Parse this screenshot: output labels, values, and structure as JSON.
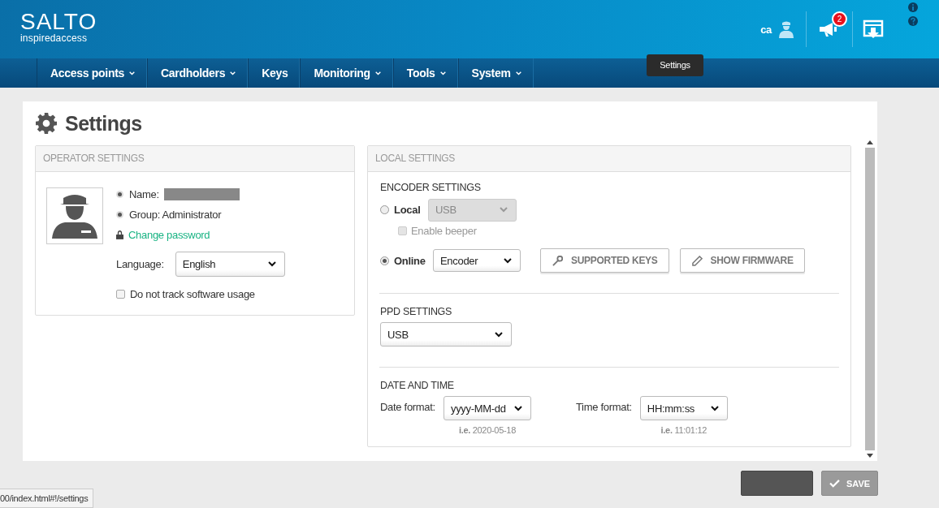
{
  "header": {
    "logo": "SALTO",
    "tagline": "inspiredaccess",
    "user_name": "ca",
    "notification_count": "2",
    "tooltip": "Settings"
  },
  "nav": [
    {
      "label": "Access points",
      "dropdown": true
    },
    {
      "label": "Cardholders",
      "dropdown": true
    },
    {
      "label": "Keys",
      "dropdown": false
    },
    {
      "label": "Monitoring",
      "dropdown": true
    },
    {
      "label": "Tools",
      "dropdown": true
    },
    {
      "label": "System",
      "dropdown": true
    }
  ],
  "page_title": "Settings",
  "operator_settings": {
    "heading": "OPERATOR SETTINGS",
    "name_label": "Name:",
    "group": "Group: Administrator",
    "change_password": "Change password",
    "language_label": "Language:",
    "language": "English",
    "track_usage": {
      "label": "Do not track software usage",
      "checked": false
    }
  },
  "local_settings": {
    "heading": "LOCAL SETTINGS",
    "encoder_title": "ENCODER SETTINGS",
    "modes": [
      {
        "label": "Local",
        "selected": false,
        "value": "USB",
        "disabled": true
      },
      {
        "label": "Online",
        "selected": true,
        "value": "Encoder",
        "disabled": false
      }
    ],
    "beeper": {
      "label": "Enable beeper",
      "checked": false,
      "disabled": true
    },
    "buttons": [
      {
        "label": "SUPPORTED KEYS",
        "kind": "key"
      },
      {
        "label": "SHOW FIRMWARE",
        "kind": "pencil"
      }
    ],
    "ppd_title": "PPD SETTINGS",
    "ppd_value": "USB",
    "date_time_title": "DATE AND TIME",
    "formats": [
      {
        "label": "Date format:",
        "value": "yyyy-MM-dd",
        "example": "**i.e.** 2020-05-18"
      },
      {
        "label": "Time format:",
        "value": "HH:mm:ss",
        "example": "**i.e.** 11:01:12"
      }
    ]
  },
  "footer": {
    "save": {
      "label": "SAVE",
      "disabled": true
    }
  },
  "status_url": "00/index.html#!/settings"
}
